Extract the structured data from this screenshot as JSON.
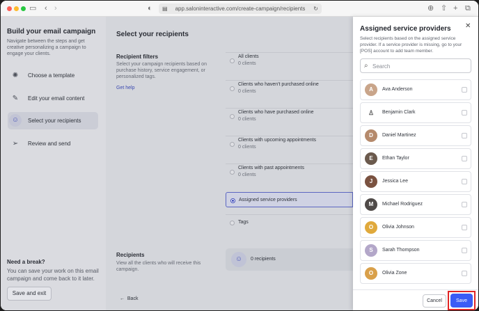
{
  "browser": {
    "url": "app.saloninteractive.com/create-campaign/recipients"
  },
  "steps_sidebar": {
    "title": "Build your email campaign",
    "description": "Navigate between the steps and get creative personalizing a campaign to engage your clients.",
    "steps": [
      {
        "label": "Choose a template",
        "icon": "palette-icon",
        "active": false
      },
      {
        "label": "Edit your email content",
        "icon": "pencil-icon",
        "active": false
      },
      {
        "label": "Select your recipients",
        "icon": "users-icon",
        "active": true
      },
      {
        "label": "Review and send",
        "icon": "send-icon",
        "active": false
      }
    ],
    "break_title": "Need a break?",
    "break_desc": "You can save your work on this email campaign and come back to it later.",
    "save_exit": "Save and exit"
  },
  "main": {
    "title": "Select your recipients",
    "filters_title": "Recipient filters",
    "filters_desc": "Select your campaign recipients based on purchase history, service engagement, or personalized tags.",
    "get_help": "Get help",
    "filters": [
      {
        "label": "All clients",
        "count": "0 clients"
      },
      {
        "label": "Clients who haven't purchased online",
        "count": "0 clients"
      },
      {
        "label": "Clients who have purchased online",
        "count": "0 clients"
      },
      {
        "label": "Clients with upcoming appointments",
        "count": "0 clients"
      },
      {
        "label": "Clients with past appointments",
        "count": "0 clients"
      },
      {
        "label": "Assigned service providers",
        "count": ""
      },
      {
        "label": "Tags",
        "count": ""
      }
    ],
    "selected_filter": "Assigned service providers",
    "recipients_title": "Recipients",
    "recipients_desc": "View all the clients who will receive this campaign.",
    "recipients_count": "0 recipients",
    "back": "Back"
  },
  "panel": {
    "title": "Assigned service providers",
    "description": "Select recipients based on the assigned service provider. If a service provider is missing, go to your [POS] account to add team member.",
    "search_placeholder": "Search",
    "providers": [
      {
        "name": "Ava Anderson",
        "avatar_color": "#c9a58a"
      },
      {
        "name": "Benjamin Clark",
        "avatar_color": "#8c8f96"
      },
      {
        "name": "Daniel Martinez",
        "avatar_color": "#b58a6c"
      },
      {
        "name": "Ethan Taylor",
        "avatar_color": "#6b5a4d"
      },
      {
        "name": "Jessica Lee",
        "avatar_color": "#7a5240"
      },
      {
        "name": "Michael Rodriguez",
        "avatar_color": "#4f4a48"
      },
      {
        "name": "Olivia Johnson",
        "avatar_color": "#e0a93c"
      },
      {
        "name": "Sarah Thompson",
        "avatar_color": "#b3a7c9"
      },
      {
        "name": "Olivia Zone",
        "avatar_color": "#d9a04a"
      }
    ],
    "cancel": "Cancel",
    "save": "Save",
    "accent": "#3b5cf6"
  }
}
